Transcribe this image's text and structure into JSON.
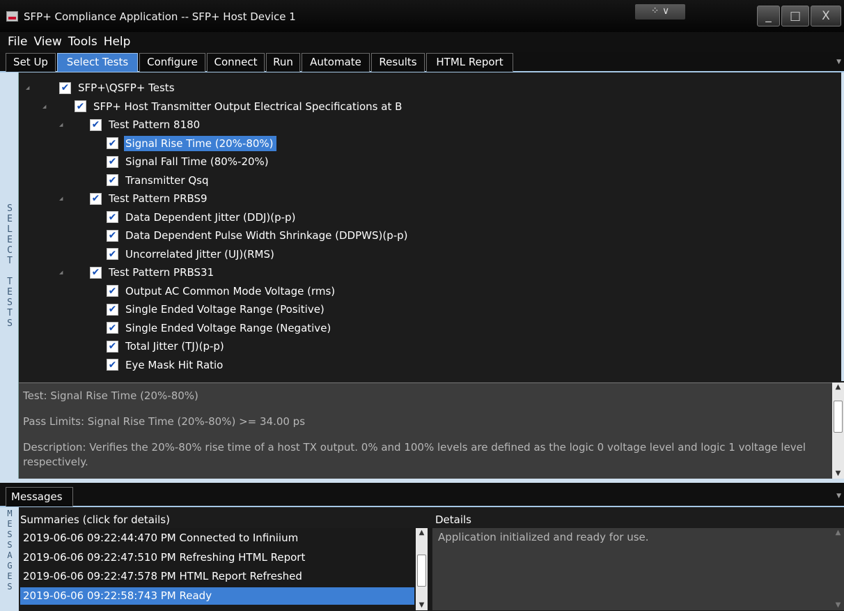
{
  "window": {
    "title": "SFP+ Compliance Application -- SFP+ Host Device 1",
    "snap_icon": "⁘ ∨",
    "min_glyph": "_",
    "max_glyph": "□",
    "close_glyph": "X"
  },
  "menu": [
    "File",
    "View",
    "Tools",
    "Help"
  ],
  "tabs": [
    "Set Up",
    "Select Tests",
    "Configure",
    "Connect",
    "Run",
    "Automate",
    "Results",
    "HTML Report"
  ],
  "active_tab": "Select Tests",
  "side_label": "SELECT TESTS",
  "tree": [
    {
      "label": "SFP+\\QSFP+ Tests",
      "level": 0,
      "checked": true,
      "expander": true
    },
    {
      "label": "SFP+ Host Transmitter Output Electrical Specifications at B",
      "level": 1,
      "checked": true,
      "expander": true
    },
    {
      "label": "Test Pattern 8180",
      "level": 2,
      "checked": true,
      "expander": true
    },
    {
      "label": "Signal Rise Time (20%-80%)",
      "level": 3,
      "checked": true,
      "selected": true
    },
    {
      "label": "Signal Fall Time (80%-20%)",
      "level": 3,
      "checked": true
    },
    {
      "label": "Transmitter Qsq",
      "level": 3,
      "checked": true
    },
    {
      "label": "Test Pattern PRBS9",
      "level": 2,
      "checked": true,
      "expander": true
    },
    {
      "label": "Data Dependent Jitter (DDJ)(p-p)",
      "level": 3,
      "checked": true
    },
    {
      "label": "Data Dependent Pulse Width Shrinkage (DDPWS)(p-p)",
      "level": 3,
      "checked": true
    },
    {
      "label": "Uncorrelated Jitter (UJ)(RMS)",
      "level": 3,
      "checked": true
    },
    {
      "label": "Test Pattern PRBS31",
      "level": 2,
      "checked": true,
      "expander": true
    },
    {
      "label": "Output AC Common Mode Voltage (rms)",
      "level": 3,
      "checked": true
    },
    {
      "label": "Single Ended Voltage Range (Positive)",
      "level": 3,
      "checked": true
    },
    {
      "label": "Single Ended Voltage Range (Negative)",
      "level": 3,
      "checked": true
    },
    {
      "label": "Total Jitter (TJ)(p-p)",
      "level": 3,
      "checked": true
    },
    {
      "label": "Eye Mask Hit Ratio",
      "level": 3,
      "checked": true
    }
  ],
  "description": {
    "test": "Test: Signal Rise Time (20%-80%)",
    "pass_limits": "Pass Limits: Signal Rise Time (20%-80%) >= 34.00 ps",
    "text": "Description: Verifies the 20%-80% rise time of a host TX output. 0% and 100% levels are defined as the logic 0 voltage level and logic 1 voltage level respectively."
  },
  "messages": {
    "tab_label": "Messages",
    "side_label": "MESSAGES",
    "summaries_header": "Summaries (click for details)",
    "details_header": "Details",
    "summaries": [
      "2019-06-06 09:22:44:470 PM Connected to Infiniium",
      "2019-06-06 09:22:47:510 PM Refreshing HTML Report",
      "2019-06-06 09:22:47:578 PM HTML Report Refreshed",
      "2019-06-06 09:22:58:743 PM Ready"
    ],
    "selected_index": 3,
    "details_text": "Application initialized and ready for use."
  },
  "colors": {
    "accent": "#3d7fd4",
    "panel_border": "#cfe0ef",
    "check": "#1550b8"
  }
}
